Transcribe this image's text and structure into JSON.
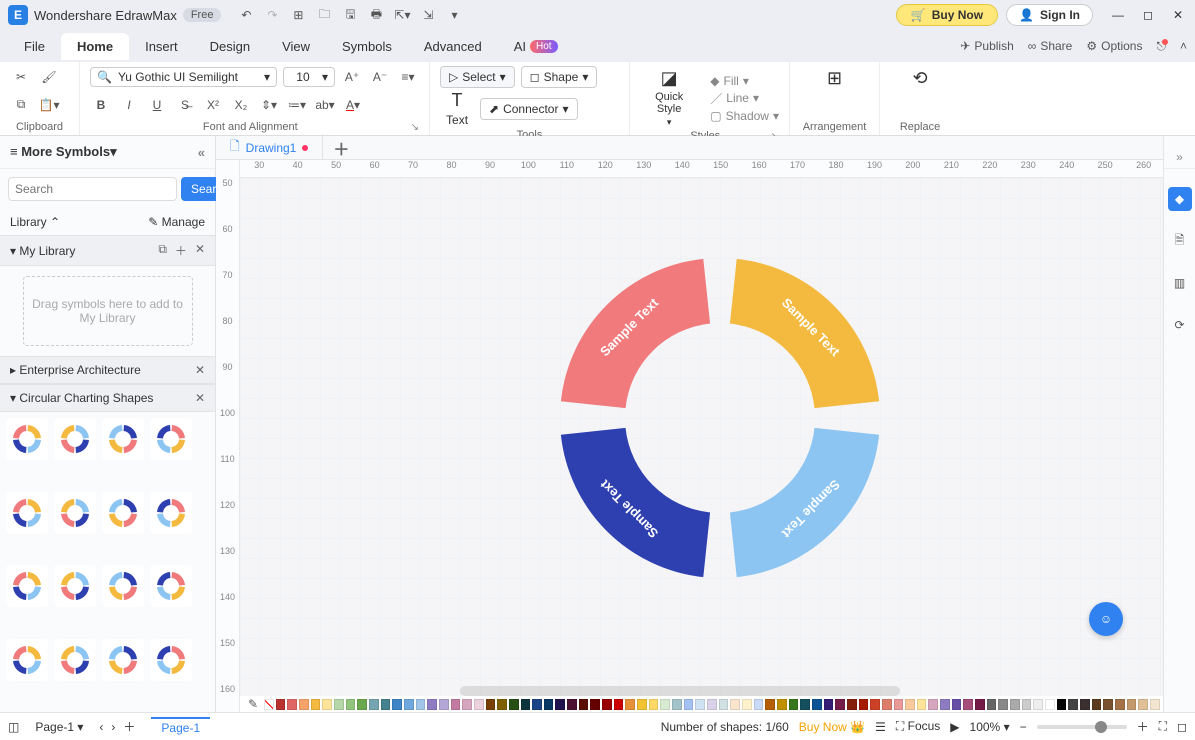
{
  "app": {
    "name": "Wondershare EdrawMax",
    "badge": "Free"
  },
  "titlebar": {
    "buy": "Buy Now",
    "signin": "Sign In"
  },
  "menus": {
    "file": "File",
    "home": "Home",
    "insert": "Insert",
    "design": "Design",
    "view": "View",
    "symbols": "Symbols",
    "advanced": "Advanced",
    "ai": "AI",
    "hot": "Hot",
    "publish": "Publish",
    "share": "Share",
    "options": "Options"
  },
  "ribbon": {
    "clipboard": "Clipboard",
    "fontalign": "Font and Alignment",
    "tools": "Tools",
    "styles": "Styles",
    "arrangement": "Arrangement",
    "replace": "Replace",
    "fontname": "Yu Gothic UI Semilight",
    "fontsize": "10",
    "select": "Select",
    "shape": "Shape",
    "text": "Text",
    "connector": "Connector",
    "quickstyle": "Quick Style",
    "fill": "Fill",
    "line": "Line",
    "shadow": "Shadow"
  },
  "sidebar": {
    "more": "More Symbols",
    "search_ph": "Search",
    "search_btn": "Search",
    "library": "Library",
    "manage": "Manage",
    "mylib": "My Library",
    "drop": "Drag symbols here to add to My Library",
    "ent": "Enterprise Architecture",
    "circ": "Circular Charting Shapes"
  },
  "filetab": {
    "name": "Drawing1"
  },
  "ruler_h": [
    "30",
    "40",
    "50",
    "60",
    "70",
    "80",
    "90",
    "100",
    "110",
    "120",
    "130",
    "140",
    "150",
    "160",
    "170",
    "180",
    "190",
    "200",
    "210",
    "220",
    "230",
    "240",
    "250",
    "260"
  ],
  "ruler_v": [
    "50",
    "60",
    "70",
    "80",
    "90",
    "100",
    "110",
    "120",
    "130",
    "140",
    "150",
    "160"
  ],
  "chart_data": {
    "type": "pie",
    "segments": [
      {
        "label": "Sample Text",
        "color": "#f4b93f"
      },
      {
        "label": "Sample Text",
        "color": "#8cc4f2"
      },
      {
        "label": "Sample Text",
        "color": "#2e3fb0"
      },
      {
        "label": "Sample Text",
        "color": "#f07a7c"
      }
    ]
  },
  "status": {
    "page": "Page-1",
    "pagetab": "Page-1",
    "shapes": "Number of shapes: 1/60",
    "buy": "Buy Now",
    "focus": "Focus",
    "zoom": "100%"
  },
  "colors": [
    "#b93230",
    "#e06666",
    "#f6a26b",
    "#f4b93f",
    "#ffe599",
    "#b6d7a8",
    "#93c47d",
    "#6aa84f",
    "#76a5af",
    "#45818e",
    "#3d85c6",
    "#6fa8dc",
    "#9fc5e8",
    "#8e7cc3",
    "#b4a7d6",
    "#c27ba0",
    "#d5a6bd",
    "#ead1dc",
    "#783f04",
    "#7f6000",
    "#274e13",
    "#0c343d",
    "#1c4587",
    "#073763",
    "#20124d",
    "#4c1130",
    "#5b0f00",
    "#660000",
    "#990000",
    "#cc0000",
    "#e69138",
    "#f1c232",
    "#ffd966",
    "#d9ead3",
    "#a2c4c9",
    "#a4c2f4",
    "#cfe2f3",
    "#d9d2e9",
    "#d0e0e3",
    "#fce5cd",
    "#fff2cc",
    "#c9daf8",
    "#b45f06",
    "#bf9000",
    "#38761d",
    "#134f5c",
    "#0b5394",
    "#351c75",
    "#741b47",
    "#85200c",
    "#a61c00",
    "#cc4125",
    "#dd7e6b",
    "#ea9999",
    "#f9cb9c",
    "#ffe599",
    "#d5a6bd",
    "#8e7cc3",
    "#674ea7",
    "#a64d79",
    "#741b47",
    "#666666",
    "#888888",
    "#aaaaaa",
    "#cccccc",
    "#eeeeee",
    "#ffffff",
    "#000000",
    "#434343",
    "#3c2f2f",
    "#5b3a1e",
    "#7a5230",
    "#a47148",
    "#c49a6c",
    "#e0c097",
    "#f3e5d0"
  ]
}
